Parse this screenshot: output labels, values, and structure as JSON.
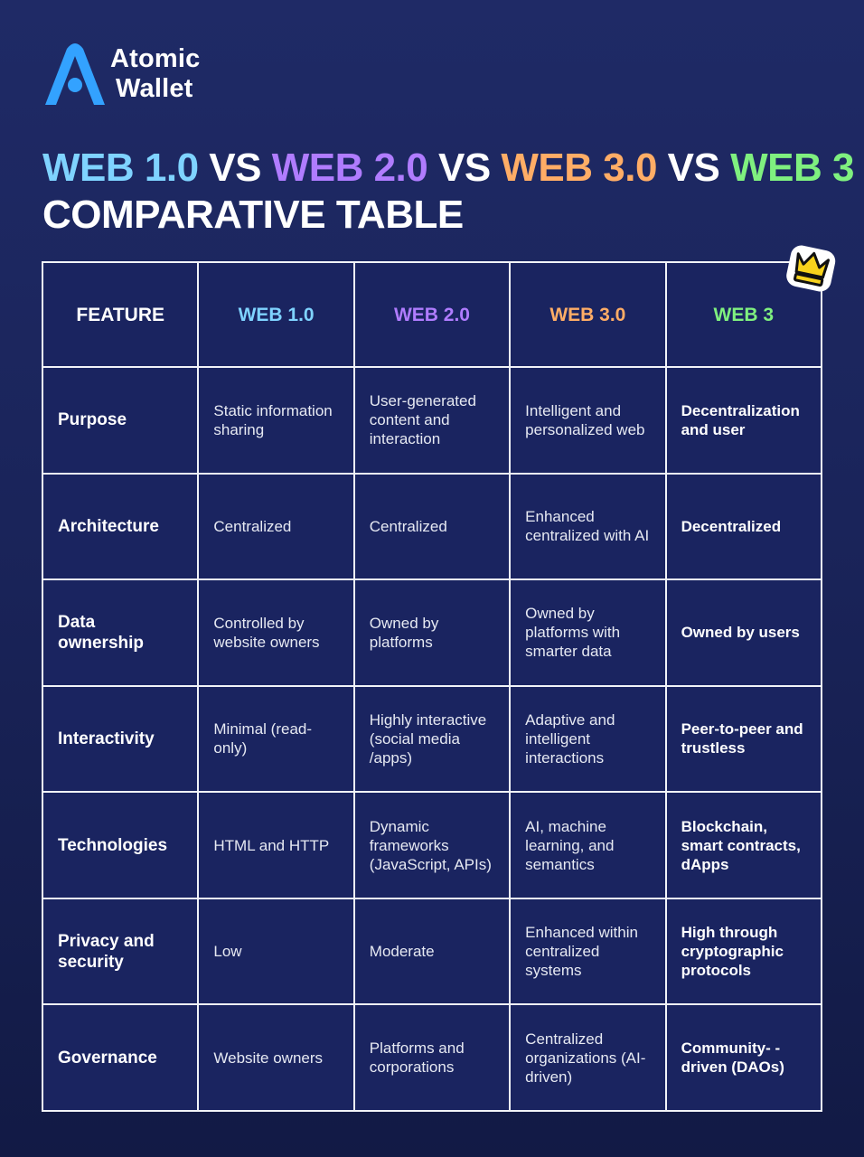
{
  "brand": {
    "name_line1": "Atomic",
    "name_line2": "Wallet",
    "logo_icon": "atomic-a-logo-icon",
    "color": "#33a2ff"
  },
  "title": {
    "parts": [
      {
        "text": "WEB 1.0",
        "color": "#7fd3ff"
      },
      {
        "text": " VS ",
        "color": "#ffffff"
      },
      {
        "text": "WEB 2.0",
        "color": "#b07cff"
      },
      {
        "text": " VS ",
        "color": "#ffffff"
      },
      {
        "text": "WEB 3.0",
        "color": "#ffad66"
      },
      {
        "text": " VS ",
        "color": "#ffffff"
      },
      {
        "text": "WEB 3",
        "color": "#7ff07f"
      }
    ],
    "line2": "COMPARATIVE TABLE"
  },
  "decoration": {
    "crown_icon": "crown-icon",
    "crown_color": "#f7d21c"
  },
  "table": {
    "headers": [
      {
        "label": "FEATURE",
        "color": "#ffffff"
      },
      {
        "label": "WEB 1.0",
        "color": "#7fd3ff"
      },
      {
        "label": "WEB 2.0",
        "color": "#b07cff"
      },
      {
        "label": "WEB 3.0",
        "color": "#ffad66"
      },
      {
        "label": "WEB 3",
        "color": "#7ff07f"
      }
    ],
    "rows": [
      {
        "feature": "Purpose",
        "web1": "Static information sharing",
        "web2": "User-generated content and interaction",
        "web30": "Intelligent and personalized web",
        "web3": "Decentralization and user"
      },
      {
        "feature": "Architecture",
        "web1": "Centralized",
        "web2": "Centralized",
        "web30": "Enhanced centralized with AI",
        "web3": "Decentralized"
      },
      {
        "feature": "Data ownership",
        "web1": "Controlled by website owners",
        "web2": "Owned by platforms",
        "web30": "Owned by platforms with smarter data",
        "web3": "Owned by users"
      },
      {
        "feature": "Interactivity",
        "web1": "Minimal (read-only)",
        "web2": "Highly interactive (social media /apps)",
        "web30": "Adaptive and intelligent interactions",
        "web3": "Peer-to-peer and trustless"
      },
      {
        "feature": "Technologies",
        "web1": "HTML and HTTP",
        "web2": "Dynamic frameworks (JavaScript, APIs)",
        "web30": "AI, machine learning, and semantics",
        "web3": "Blockchain, smart contracts, dApps"
      },
      {
        "feature": "Privacy and security",
        "web1": "Low",
        "web2": "Moderate",
        "web30": "Enhanced within centralized systems",
        "web3": "High through cryptographic protocols"
      },
      {
        "feature": "Governance",
        "web1": "Website owners",
        "web2": "Platforms and corporations",
        "web30": "Centralized organizations (AI-driven)",
        "web3": "Community- -driven (DAOs)"
      }
    ]
  }
}
